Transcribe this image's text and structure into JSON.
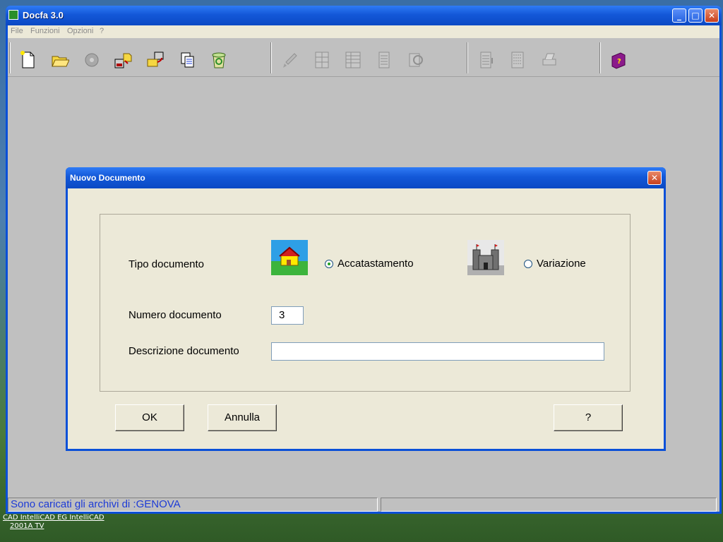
{
  "window": {
    "title": "Docfa 3.0"
  },
  "menu": {
    "items": [
      "File",
      "Funzioni",
      "Opzioni",
      "?"
    ]
  },
  "toolbar": {
    "icons": [
      "new-document-icon",
      "open-folder-icon",
      "disabled-gear-icon",
      "export-icon",
      "transfer-icon",
      "copy-icon",
      "recycle-icon",
      "brush-icon",
      "grid-icon",
      "table-icon",
      "list-icon",
      "print-preview-icon",
      "report-icon",
      "document-icon",
      "printer-icon",
      "help-book-icon"
    ]
  },
  "dialog": {
    "title": "Nuovo Documento",
    "tipo_label": "Tipo documento",
    "option_accatastamento": "Accatastamento",
    "option_variazione": "Variazione",
    "selected_option": "Accatastamento",
    "numero_label": "Numero documento",
    "numero_value": "3",
    "descrizione_label": "Descrizione documento",
    "descrizione_value": "",
    "ok_label": "OK",
    "annulla_label": "Annulla",
    "help_label": "?"
  },
  "status": {
    "left": "Sono caricati gli archivi di :GENOVA",
    "right": ""
  },
  "desktop": {
    "shortcut_line1": "CAD IntelliCAD   EG IntelliCAD",
    "shortcut_line2": "2001A TV"
  },
  "colors": {
    "title_blue": "#0a50d8",
    "status_text": "#1d3bd6",
    "dialog_bg": "#ece9d8"
  }
}
